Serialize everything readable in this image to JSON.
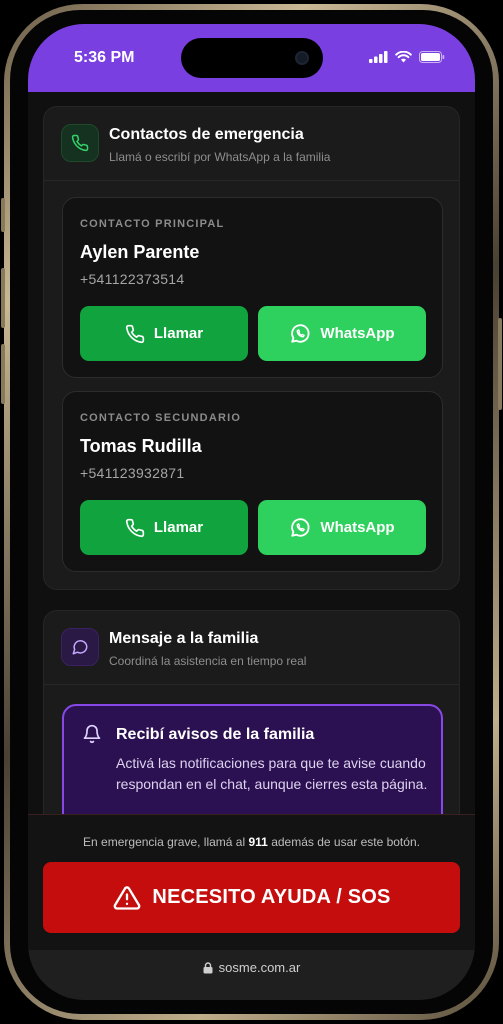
{
  "status_bar": {
    "time": "5:36 PM",
    "accent": "#7a3fe0"
  },
  "emergency_contacts": {
    "title": "Contactos de emergencia",
    "subtitle": "Llamá o escribí por WhatsApp a la familia",
    "icon": "phone-icon",
    "contacts": [
      {
        "role": "CONTACTO PRINCIPAL",
        "name": "Aylen Parente",
        "phone": "+541122373514",
        "call_label": "Llamar",
        "whatsapp_label": "WhatsApp"
      },
      {
        "role": "CONTACTO SECUNDARIO",
        "name": "Tomas Rudilla",
        "phone": "+541123932871",
        "call_label": "Llamar",
        "whatsapp_label": "WhatsApp"
      }
    ]
  },
  "family_message": {
    "title": "Mensaje a la familia",
    "subtitle": "Coordiná la asistencia en tiempo real",
    "icon": "chat-bubble-icon",
    "notification": {
      "title": "Recibí avisos de la familia",
      "body": "Activá las notificaciones para que te avise cuando respondan en el chat, aunque cierres esta página.",
      "icon": "bell-icon"
    }
  },
  "sos": {
    "warning_prefix": "En emergencia grave, llamá al",
    "warning_number": "911",
    "warning_suffix": "además de usar este botón.",
    "button_label": "NECESITO AYUDA / SOS",
    "color": "#c60d0d"
  },
  "browser": {
    "url": "sosme.com.ar"
  }
}
